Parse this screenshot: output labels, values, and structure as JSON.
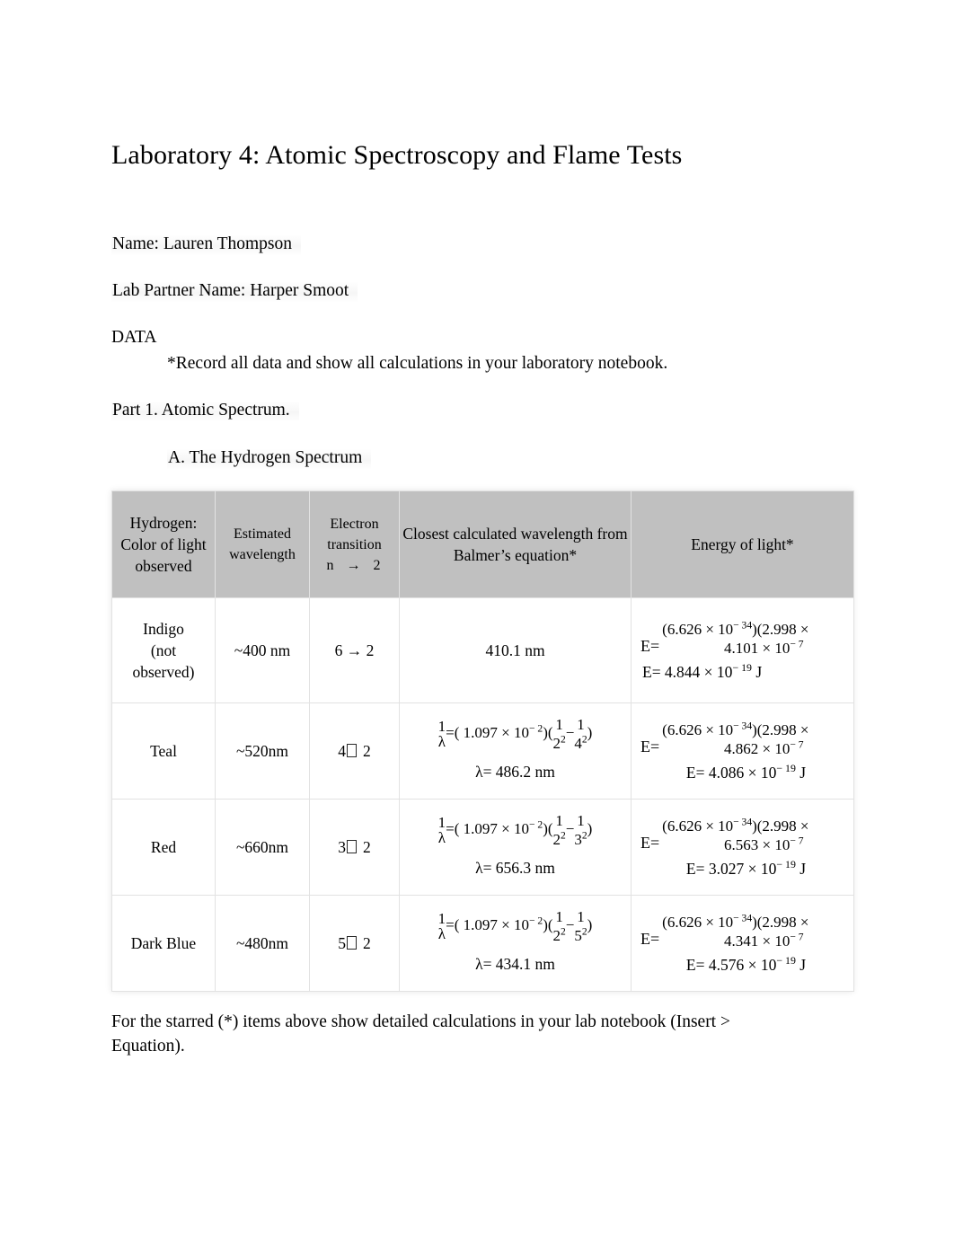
{
  "document": {
    "title": "Laboratory 4: Atomic Spectroscopy and Flame Tests",
    "name_line": "Name: Lauren Thompson",
    "partner_line": "Lab Partner Name: Harper Smoot",
    "data_heading": "DATA",
    "data_note": "*Record all data and show all calculations in your laboratory notebook.",
    "part_heading": "Part 1. Atomic Spectrum.",
    "section_heading": "A. The Hydrogen Spectrum",
    "footnote": "For the starred (*) items above show detailed calculations in your lab notebook (Insert > Equation)."
  },
  "table": {
    "header_bg": "#c0c0c0",
    "headers": {
      "color_observed": "Hydrogen: Color of light observed",
      "estimated_wavelength": "Estimated wavelength",
      "electron_transition_l1": "Electron",
      "electron_transition_l2": "transition",
      "electron_transition_l3": "n",
      "electron_transition_l4": "2",
      "closest_calculated": "Closest calculated wavelength from Balmer’s equation*",
      "energy_of_light": "Energy of light*"
    },
    "rows": [
      {
        "color": "Indigo (not observed)",
        "color_l1": "Indigo",
        "color_l2": "(not",
        "color_l3": "observed)",
        "estimated": "~400 nm",
        "transition_from": "6",
        "transition_to": "2",
        "transition_arrow": "→",
        "balmer_plain": "410.1 nm",
        "has_balmer_equation": false,
        "energy": {
          "label": "E=",
          "h": "6.626",
          "h_exp": "− 34",
          "c": "2.998",
          "lambda": "4.101",
          "lambda_exp": "− 7",
          "result_label": "E=",
          "result_value": "4.844",
          "result_exp": "− 19",
          "result_unit": "J"
        }
      },
      {
        "color": "Teal",
        "estimated": "~520nm",
        "transition_from": "4",
        "transition_to": "2",
        "transition_arrow": "tofu",
        "has_balmer_equation": true,
        "balmer": {
          "lhs_num": "1",
          "lhs_den": "λ",
          "eq": "=(",
          "rydberg": "1.097",
          "rydberg_exp": "− 2",
          "close_open": ")(",
          "t1_num": "1",
          "t1_den": "2",
          "t1_den_exp": "2",
          "op": "−",
          "t2_num": "1",
          "t2_den": "4",
          "t2_den_exp": "2",
          "close": ")",
          "result": "λ= 486.2 nm"
        },
        "energy": {
          "label": "E=",
          "h": "6.626",
          "h_exp": "− 34",
          "c": "2.998",
          "lambda": "4.862",
          "lambda_exp": "− 7",
          "result_label": "E=",
          "result_value": "4.086",
          "result_exp": "− 19",
          "result_unit": "J"
        }
      },
      {
        "color": "Red",
        "estimated": "~660nm",
        "transition_from": "3",
        "transition_to": "2",
        "transition_arrow": "tofu",
        "has_balmer_equation": true,
        "balmer": {
          "lhs_num": "1",
          "lhs_den": "λ",
          "eq": "=(",
          "rydberg": "1.097",
          "rydberg_exp": "− 2",
          "close_open": ")(",
          "t1_num": "1",
          "t1_den": "2",
          "t1_den_exp": "2",
          "op": "−",
          "t2_num": "1",
          "t2_den": "3",
          "t2_den_exp": "2",
          "close": ")",
          "result": "λ= 656.3 nm"
        },
        "energy": {
          "label": "E=",
          "h": "6.626",
          "h_exp": "− 34",
          "c": "2.998",
          "lambda": "6.563",
          "lambda_exp": "− 7",
          "result_label": "E=",
          "result_value": "3.027",
          "result_exp": "− 19",
          "result_unit": "J"
        }
      },
      {
        "color": "Dark Blue",
        "estimated": "~480nm",
        "transition_from": "5",
        "transition_to": "2",
        "transition_arrow": "tofu",
        "has_balmer_equation": true,
        "balmer": {
          "lhs_num": "1",
          "lhs_den": "λ",
          "eq": "=(",
          "rydberg": "1.097",
          "rydberg_exp": "− 2",
          "close_open": ")(",
          "t1_num": "1",
          "t1_den": "2",
          "t1_den_exp": "2",
          "op": "−",
          "t2_num": "1",
          "t2_den": "5",
          "t2_den_exp": "2",
          "close": ")",
          "result": "λ= 434.1 nm"
        },
        "energy": {
          "label": "E=",
          "h": "6.626",
          "h_exp": "− 34",
          "c": "2.998",
          "lambda": "4.341",
          "lambda_exp": "− 7",
          "result_label": "E=",
          "result_value": "4.576",
          "result_exp": "− 19",
          "result_unit": "J"
        }
      }
    ],
    "symbols": {
      "times": "×",
      "ten": "10",
      "open_paren": "(",
      "close_paren": ")"
    }
  }
}
